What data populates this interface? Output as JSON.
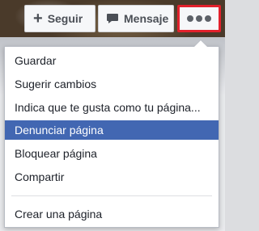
{
  "actions": {
    "follow_label": "Seguir",
    "message_label": "Mensaje",
    "more_icon": "more-dots-icon",
    "more_highlight_color": "#e2202b"
  },
  "menu": {
    "items": [
      {
        "label": "Guardar"
      },
      {
        "label": "Sugerir cambios"
      },
      {
        "label": "Indica que te gusta como tu página..."
      },
      {
        "label": "Denunciar página",
        "active": true
      },
      {
        "label": "Bloquear página"
      },
      {
        "label": "Compartir"
      },
      {
        "label": "Crear una página"
      }
    ],
    "active_color": "#4267b2"
  }
}
